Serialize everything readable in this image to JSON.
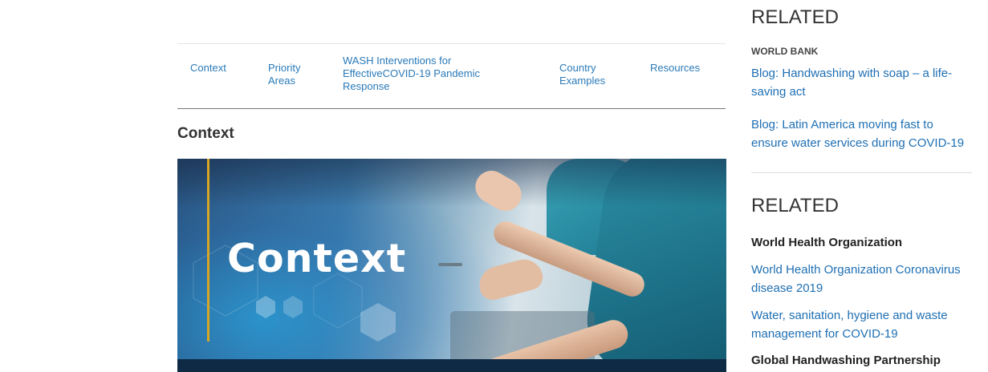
{
  "tabs": [
    {
      "label": "Context"
    },
    {
      "label": "Priority Areas"
    },
    {
      "label": "WASH Interventions for EffectiveCOVID-19 Pandemic Response"
    },
    {
      "label": "Country Examples"
    },
    {
      "label": "Resources"
    }
  ],
  "section_title": "Context",
  "hero": {
    "text": "Context",
    "accent_color": "#d8a623"
  },
  "sidebar": {
    "related1": {
      "heading": "RELATED",
      "source": "WORLD BANK",
      "links": [
        "Blog: Handwashing with soap – a life-saving act",
        "Blog: Latin America moving fast to ensure water services during COVID-19"
      ]
    },
    "related2": {
      "heading": "RELATED",
      "source1": "World Health Organization",
      "links": [
        "World Health Organization Coronavirus disease 2019",
        "Water, sanitation, hygiene and waste management for COVID-19"
      ],
      "source2": "Global Handwashing Partnership"
    }
  },
  "colors": {
    "link": "#1f6fb3",
    "tab": "#2a7ab8"
  }
}
